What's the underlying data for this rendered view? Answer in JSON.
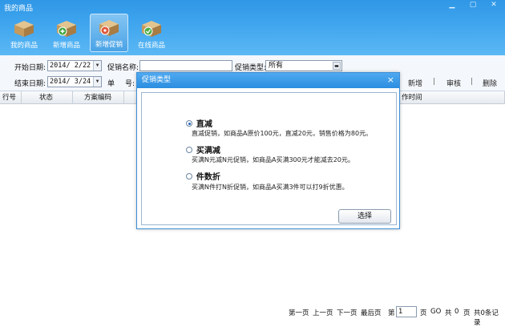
{
  "app": {
    "title": "我的商品"
  },
  "window_controls": {
    "minimize": "▁",
    "maximize": "▢",
    "close": "✕"
  },
  "toolbar": [
    {
      "label": "我的商品",
      "icon": "box-icon",
      "active": false
    },
    {
      "label": "新增商品",
      "icon": "box-add-icon",
      "active": false
    },
    {
      "label": "新增促销",
      "icon": "box-promo-icon",
      "active": true
    },
    {
      "label": "在线商品",
      "icon": "box-online-icon",
      "active": false
    }
  ],
  "filters": {
    "start_date_label": "开始日期:",
    "start_date": "2014/ 2/22",
    "end_date_label": "结束日期:",
    "end_date": "2014/ 3/24",
    "promo_name_label": "促销名称:",
    "promo_name_value": "",
    "promo_type_label": "促销类型:",
    "promo_type_value": "所有",
    "order_label_1": "单",
    "order_label_2": "号:"
  },
  "actions": {
    "add": "新增",
    "review": "审核",
    "delete": "删除",
    "sep": "|"
  },
  "table": {
    "columns": [
      "行号",
      "状态",
      "方案编码",
      "作时间"
    ]
  },
  "pager": {
    "first": "第一页",
    "prev": "上一页",
    "next": "下一页",
    "last": "最后页",
    "page_prefix": "第",
    "page_value": "1",
    "page_suffix": "页",
    "go": "GO",
    "total_prefix": "共",
    "total_pages": "0",
    "total_pages_suffix": "页",
    "total_records": "共0条记录"
  },
  "modal": {
    "title": "促销类型",
    "close": "×",
    "options": [
      {
        "title": "直减",
        "desc": "直减促销，如商品A原价100元，直减20元，销售价格为80元。",
        "checked": true
      },
      {
        "title": "买满减",
        "desc": "买满N元减N元促销，如商品A买满300元才能减去20元。",
        "checked": false
      },
      {
        "title": "件数折",
        "desc": "买满N件打N折促销，如商品A买满3件可以打9折优惠。",
        "checked": false
      }
    ],
    "choose_button": "选择"
  },
  "colors": {
    "header_blue": "#3ea4ee",
    "modal_border": "#3c8ed6",
    "box_tan": "#c9a26a"
  }
}
